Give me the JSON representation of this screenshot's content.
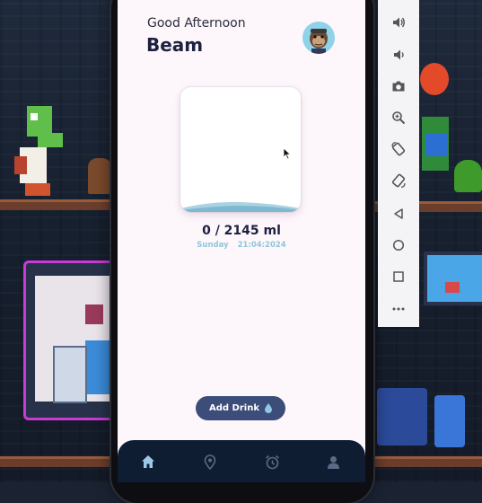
{
  "app": {
    "greeting": "Good Afternoon",
    "user_name": "Beam",
    "intake": "0 / 2145 ml",
    "day": "Sunday",
    "date": "21:04:2024",
    "add_button_label": "Add Drink",
    "fill_level": 0.0
  },
  "navbar": {
    "items": [
      {
        "icon": "home-icon",
        "active": true
      },
      {
        "icon": "location-pin-icon",
        "active": false
      },
      {
        "icon": "alarm-clock-icon",
        "active": false
      },
      {
        "icon": "profile-icon",
        "active": false
      }
    ]
  },
  "emulator_toolbar": {
    "buttons": [
      "volume-up-icon",
      "volume-down-icon",
      "camera-icon",
      "zoom-in-icon",
      "rotate-left-icon",
      "rotate-right-icon",
      "back-icon",
      "home-circle-icon",
      "overview-square-icon",
      "more-icon"
    ]
  },
  "colors": {
    "screen_bg": "#fdf6fb",
    "title": "#1d2140",
    "accent_blue": "#3c4d7a",
    "water": "#a9d3e3",
    "navbar": "#0f1d33",
    "nav_active": "#9ec9e6",
    "nav_inactive": "#5b6a85"
  }
}
